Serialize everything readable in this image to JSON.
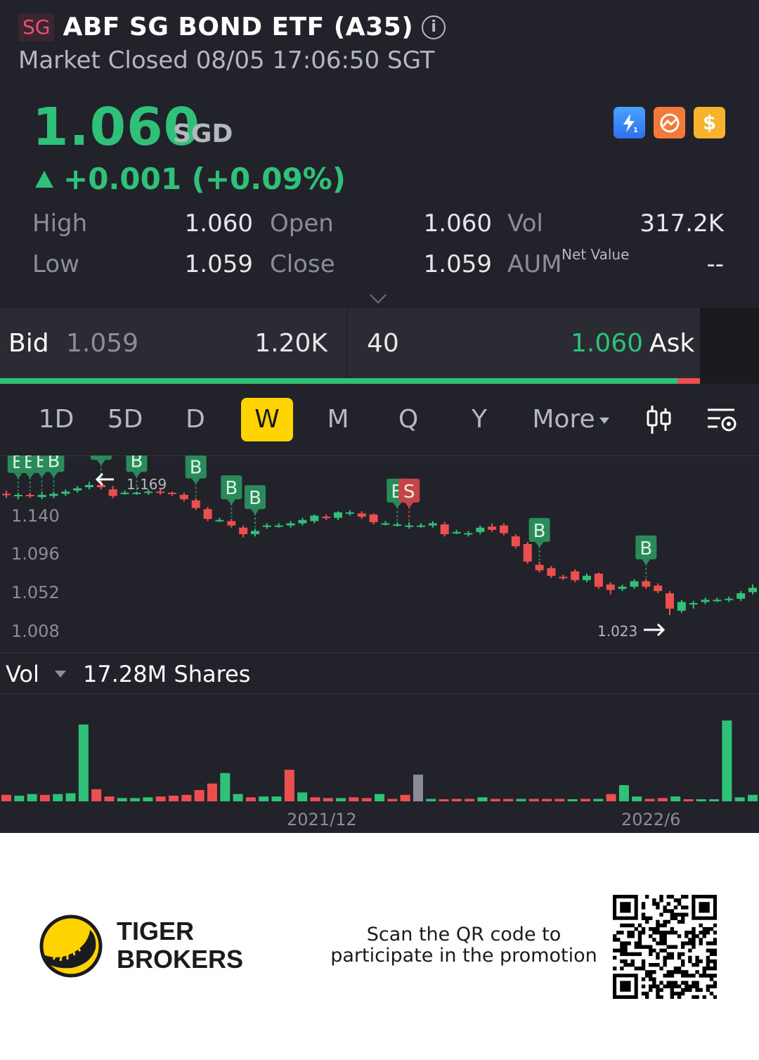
{
  "header": {
    "market_badge": "SG",
    "title": "ABF SG BOND ETF (A35)",
    "status": "Market Closed 08/05 17:06:50 SGT"
  },
  "quote": {
    "price": "1.060",
    "currency": "SGD",
    "change": "+0.001 (+0.09%)",
    "up_color": "#2fc178",
    "down_color": "#ec4f4f"
  },
  "badges": [
    "lightning-1-icon",
    "chart-circle-icon",
    "dollar-icon"
  ],
  "stats": {
    "high_label": "High",
    "high": "1.060",
    "low_label": "Low",
    "low": "1.059",
    "open_label": "Open",
    "open": "1.060",
    "close_label": "Close",
    "close": "1.059",
    "vol_label": "Vol",
    "vol": "317.2K",
    "aum_label": "AUM",
    "aum_sup": "Net Value",
    "aum": "--"
  },
  "bidask": {
    "bid_label": "Bid",
    "bid_price": "1.059",
    "bid_size": "1.20K",
    "ask_size": "40",
    "ask_price": "1.060",
    "ask_label": "Ask",
    "bid_fraction": 0.968
  },
  "tabs": {
    "items": [
      "1D",
      "5D",
      "D",
      "W",
      "M",
      "Q",
      "Y"
    ],
    "active": "W",
    "more": "More"
  },
  "chart_data": {
    "type": "candlestick",
    "y_ticks": [
      "1.140",
      "1.096",
      "1.052",
      "1.008"
    ],
    "ylim": [
      1.0,
      1.18
    ],
    "high_marker": "1.169",
    "low_marker": "1.023",
    "x_ticks": [
      "2021/12",
      "2022/6"
    ],
    "candles": [
      {
        "o": 1.145,
        "c": 1.144,
        "h": 1.148,
        "l": 1.141
      },
      {
        "o": 1.143,
        "c": 1.144,
        "h": 1.146,
        "l": 1.14
      },
      {
        "o": 1.144,
        "c": 1.143,
        "h": 1.146,
        "l": 1.141
      },
      {
        "o": 1.142,
        "c": 1.144,
        "h": 1.147,
        "l": 1.14
      },
      {
        "o": 1.143,
        "c": 1.145,
        "h": 1.147,
        "l": 1.141
      },
      {
        "o": 1.145,
        "c": 1.147,
        "h": 1.149,
        "l": 1.143
      },
      {
        "o": 1.148,
        "c": 1.15,
        "h": 1.152,
        "l": 1.146
      },
      {
        "o": 1.151,
        "c": 1.153,
        "h": 1.156,
        "l": 1.149
      },
      {
        "o": 1.153,
        "c": 1.151,
        "h": 1.158,
        "l": 1.149
      },
      {
        "o": 1.149,
        "c": 1.143,
        "h": 1.152,
        "l": 1.141
      },
      {
        "o": 1.146,
        "c": 1.146,
        "h": 1.148,
        "l": 1.144
      },
      {
        "o": 1.146,
        "c": 1.146,
        "h": 1.147,
        "l": 1.144
      },
      {
        "o": 1.146,
        "c": 1.147,
        "h": 1.149,
        "l": 1.144
      },
      {
        "o": 1.147,
        "c": 1.146,
        "h": 1.149,
        "l": 1.144
      },
      {
        "o": 1.146,
        "c": 1.145,
        "h": 1.147,
        "l": 1.143
      },
      {
        "o": 1.144,
        "c": 1.14,
        "h": 1.146,
        "l": 1.138
      },
      {
        "o": 1.139,
        "c": 1.132,
        "h": 1.141,
        "l": 1.13
      },
      {
        "o": 1.131,
        "c": 1.122,
        "h": 1.133,
        "l": 1.12
      },
      {
        "o": 1.121,
        "c": 1.121,
        "h": 1.123,
        "l": 1.119
      },
      {
        "o": 1.12,
        "c": 1.116,
        "h": 1.122,
        "l": 1.114
      },
      {
        "o": 1.114,
        "c": 1.108,
        "h": 1.116,
        "l": 1.105
      },
      {
        "o": 1.108,
        "c": 1.111,
        "h": 1.113,
        "l": 1.106
      },
      {
        "o": 1.116,
        "c": 1.116,
        "h": 1.118,
        "l": 1.113
      },
      {
        "o": 1.116,
        "c": 1.116,
        "h": 1.118,
        "l": 1.114
      },
      {
        "o": 1.116,
        "c": 1.118,
        "h": 1.12,
        "l": 1.114
      },
      {
        "o": 1.118,
        "c": 1.121,
        "h": 1.123,
        "l": 1.116
      },
      {
        "o": 1.12,
        "c": 1.125,
        "h": 1.126,
        "l": 1.118
      },
      {
        "o": 1.124,
        "c": 1.123,
        "h": 1.126,
        "l": 1.121
      },
      {
        "o": 1.123,
        "c": 1.128,
        "h": 1.129,
        "l": 1.121
      },
      {
        "o": 1.127,
        "c": 1.128,
        "h": 1.13,
        "l": 1.125
      },
      {
        "o": 1.127,
        "c": 1.124,
        "h": 1.129,
        "l": 1.122
      },
      {
        "o": 1.126,
        "c": 1.119,
        "h": 1.127,
        "l": 1.117
      },
      {
        "o": 1.118,
        "c": 1.118,
        "h": 1.12,
        "l": 1.116
      },
      {
        "o": 1.117,
        "c": 1.117,
        "h": 1.119,
        "l": 1.115
      },
      {
        "o": 1.116,
        "c": 1.116,
        "h": 1.119,
        "l": 1.113
      },
      {
        "o": 1.116,
        "c": 1.116,
        "h": 1.118,
        "l": 1.114
      },
      {
        "o": 1.116,
        "c": 1.118,
        "h": 1.12,
        "l": 1.114
      },
      {
        "o": 1.117,
        "c": 1.108,
        "h": 1.119,
        "l": 1.106
      },
      {
        "o": 1.11,
        "c": 1.11,
        "h": 1.112,
        "l": 1.108
      },
      {
        "o": 1.109,
        "c": 1.109,
        "h": 1.111,
        "l": 1.106
      },
      {
        "o": 1.11,
        "c": 1.114,
        "h": 1.116,
        "l": 1.108
      },
      {
        "o": 1.115,
        "c": 1.112,
        "h": 1.118,
        "l": 1.11
      },
      {
        "o": 1.116,
        "c": 1.109,
        "h": 1.118,
        "l": 1.107
      },
      {
        "o": 1.106,
        "c": 1.097,
        "h": 1.108,
        "l": 1.095
      },
      {
        "o": 1.099,
        "c": 1.083,
        "h": 1.101,
        "l": 1.081
      },
      {
        "o": 1.08,
        "c": 1.075,
        "h": 1.083,
        "l": 1.073
      },
      {
        "o": 1.077,
        "c": 1.07,
        "h": 1.079,
        "l": 1.068
      },
      {
        "o": 1.069,
        "c": 1.068,
        "h": 1.071,
        "l": 1.066
      },
      {
        "o": 1.074,
        "c": 1.066,
        "h": 1.076,
        "l": 1.064
      },
      {
        "o": 1.066,
        "c": 1.07,
        "h": 1.072,
        "l": 1.064
      },
      {
        "o": 1.072,
        "c": 1.06,
        "h": 1.073,
        "l": 1.058
      },
      {
        "o": 1.062,
        "c": 1.057,
        "h": 1.064,
        "l": 1.053
      },
      {
        "o": 1.058,
        "c": 1.06,
        "h": 1.062,
        "l": 1.056
      },
      {
        "o": 1.06,
        "c": 1.065,
        "h": 1.067,
        "l": 1.058
      },
      {
        "o": 1.065,
        "c": 1.06,
        "h": 1.067,
        "l": 1.058
      },
      {
        "o": 1.061,
        "c": 1.056,
        "h": 1.063,
        "l": 1.054
      },
      {
        "o": 1.054,
        "c": 1.04,
        "h": 1.056,
        "l": 1.034
      },
      {
        "o": 1.038,
        "c": 1.046,
        "h": 1.048,
        "l": 1.036
      },
      {
        "o": 1.044,
        "c": 1.045,
        "h": 1.047,
        "l": 1.04
      },
      {
        "o": 1.046,
        "c": 1.048,
        "h": 1.05,
        "l": 1.044
      },
      {
        "o": 1.048,
        "c": 1.048,
        "h": 1.05,
        "l": 1.046
      },
      {
        "o": 1.048,
        "c": 1.049,
        "h": 1.051,
        "l": 1.046
      },
      {
        "o": 1.049,
        "c": 1.054,
        "h": 1.056,
        "l": 1.047
      },
      {
        "o": 1.055,
        "c": 1.059,
        "h": 1.062,
        "l": 1.053
      }
    ],
    "signals": [
      {
        "i": 1,
        "type": "B"
      },
      {
        "i": 2,
        "type": "B"
      },
      {
        "i": 3,
        "type": "B"
      },
      {
        "i": 4,
        "type": "B"
      },
      {
        "i": 8,
        "type": "B"
      },
      {
        "i": 11,
        "type": "B"
      },
      {
        "i": 16,
        "type": "B"
      },
      {
        "i": 19,
        "type": "B"
      },
      {
        "i": 21,
        "type": "B"
      },
      {
        "i": 33,
        "type": "B"
      },
      {
        "i": 34,
        "type": "S"
      },
      {
        "i": 45,
        "type": "B"
      },
      {
        "i": 54,
        "type": "B"
      }
    ]
  },
  "volume": {
    "label": "Vol",
    "value": "17.28M Shares",
    "bars": [
      {
        "v": 0.8,
        "dir": "down"
      },
      {
        "v": 0.7,
        "dir": "up"
      },
      {
        "v": 0.9,
        "dir": "up"
      },
      {
        "v": 0.8,
        "dir": "down"
      },
      {
        "v": 0.9,
        "dir": "up"
      },
      {
        "v": 1.0,
        "dir": "up"
      },
      {
        "v": 9.5,
        "dir": "up"
      },
      {
        "v": 1.5,
        "dir": "down"
      },
      {
        "v": 0.6,
        "dir": "down"
      },
      {
        "v": 0.4,
        "dir": "up"
      },
      {
        "v": 0.4,
        "dir": "up"
      },
      {
        "v": 0.5,
        "dir": "up"
      },
      {
        "v": 0.6,
        "dir": "down"
      },
      {
        "v": 0.7,
        "dir": "down"
      },
      {
        "v": 0.8,
        "dir": "down"
      },
      {
        "v": 1.4,
        "dir": "down"
      },
      {
        "v": 2.2,
        "dir": "down"
      },
      {
        "v": 3.5,
        "dir": "up"
      },
      {
        "v": 0.9,
        "dir": "up"
      },
      {
        "v": 0.5,
        "dir": "down"
      },
      {
        "v": 0.6,
        "dir": "up"
      },
      {
        "v": 0.6,
        "dir": "up"
      },
      {
        "v": 3.9,
        "dir": "down"
      },
      {
        "v": 1.1,
        "dir": "up"
      },
      {
        "v": 0.5,
        "dir": "down"
      },
      {
        "v": 0.4,
        "dir": "down"
      },
      {
        "v": 0.4,
        "dir": "up"
      },
      {
        "v": 0.5,
        "dir": "down"
      },
      {
        "v": 0.4,
        "dir": "down"
      },
      {
        "v": 0.9,
        "dir": "up"
      },
      {
        "v": 0.3,
        "dir": "down"
      },
      {
        "v": 0.8,
        "dir": "down"
      },
      {
        "v": 3.3,
        "dir": "flat"
      },
      {
        "v": 0.3,
        "dir": "up"
      },
      {
        "v": 0.2,
        "dir": "down"
      },
      {
        "v": 0.3,
        "dir": "down"
      },
      {
        "v": 0.3,
        "dir": "down"
      },
      {
        "v": 0.5,
        "dir": "up"
      },
      {
        "v": 0.3,
        "dir": "down"
      },
      {
        "v": 0.3,
        "dir": "down"
      },
      {
        "v": 0.3,
        "dir": "up"
      },
      {
        "v": 0.3,
        "dir": "down"
      },
      {
        "v": 0.3,
        "dir": "down"
      },
      {
        "v": 0.3,
        "dir": "down"
      },
      {
        "v": 0.2,
        "dir": "up"
      },
      {
        "v": 0.3,
        "dir": "down"
      },
      {
        "v": 0.3,
        "dir": "up"
      },
      {
        "v": 0.9,
        "dir": "down"
      },
      {
        "v": 2.0,
        "dir": "up"
      },
      {
        "v": 0.6,
        "dir": "up"
      },
      {
        "v": 0.3,
        "dir": "down"
      },
      {
        "v": 0.4,
        "dir": "down"
      },
      {
        "v": 0.6,
        "dir": "up"
      },
      {
        "v": 0.2,
        "dir": "down"
      },
      {
        "v": 0.1,
        "dir": "up"
      },
      {
        "v": 0.1,
        "dir": "up"
      },
      {
        "v": 10.0,
        "dir": "up"
      },
      {
        "v": 0.5,
        "dir": "up"
      },
      {
        "v": 0.8,
        "dir": "up"
      }
    ]
  },
  "footer": {
    "brand_line1": "TIGER",
    "brand_line2": "BROKERS",
    "scan_line1": "Scan the QR code to",
    "scan_line2": "participate in the promotion"
  }
}
